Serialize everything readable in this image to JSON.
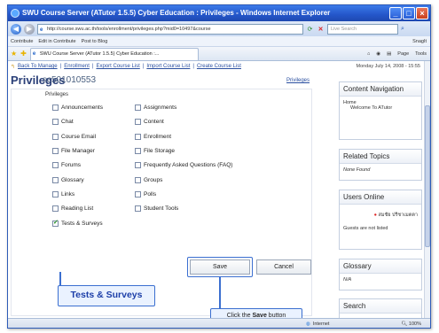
{
  "window": {
    "title": "SWU Course Server (ATutor 1.5.5) Cyber Education : Privileges - Windows Internet Explorer",
    "controls": [
      "_",
      "□",
      "×"
    ]
  },
  "addressbar": {
    "url": "http://course.swu.ac.th/tools/enrollment/privileges.php?mid0=10497&course",
    "search_placeholder": "Live Search"
  },
  "linksbar": {
    "items": [
      "Contribute",
      "Edit in Contribute",
      "Post to Blog"
    ],
    "right_items": [
      "SnagIt"
    ]
  },
  "tabbar": {
    "tab_label": "SWU Course Server (ATutor 1.5.5) Cyber Education :...",
    "commands": [
      "Page",
      "Tools"
    ]
  },
  "page": {
    "breadcrumb": [
      "Back To Manage",
      "Enrollment",
      "Export Course List",
      "Import Course List",
      "Create Course List"
    ],
    "date": "Monday July 14, 2008 - 15:55",
    "title": "Privileges",
    "help_link": "Privileges",
    "username": "sc501010553",
    "privileges_label": "Privileges",
    "privileges": [
      {
        "label": "Announcements",
        "checked": false
      },
      {
        "label": "Assignments",
        "checked": false
      },
      {
        "label": "Chat",
        "checked": false
      },
      {
        "label": "Content",
        "checked": false
      },
      {
        "label": "Course Email",
        "checked": false
      },
      {
        "label": "Enrollment",
        "checked": false
      },
      {
        "label": "File Manager",
        "checked": false
      },
      {
        "label": "File Storage",
        "checked": false
      },
      {
        "label": "Forums",
        "checked": false
      },
      {
        "label": "Frequently Asked Questions (FAQ)",
        "checked": false
      },
      {
        "label": "Glossary",
        "checked": false
      },
      {
        "label": "Groups",
        "checked": false
      },
      {
        "label": "Links",
        "checked": false
      },
      {
        "label": "Polls",
        "checked": false
      },
      {
        "label": "Reading List",
        "checked": false
      },
      {
        "label": "Student Tools",
        "checked": false
      },
      {
        "label": "Tests & Surveys",
        "checked": true
      }
    ],
    "save_label": "Save",
    "cancel_label": "Cancel",
    "callout_label": "Tests & Surveys",
    "tip_prefix": "Click the ",
    "tip_bold": "Save",
    "tip_suffix": " button"
  },
  "sidebar": {
    "panels": [
      {
        "title": "Content Navigation",
        "body_top": "Home",
        "body": "Welcome To ATutor"
      },
      {
        "title": "Related Topics",
        "body": "None Found"
      },
      {
        "title": "Users Online",
        "body_top": "สมชัย ปรีชาเมตตา",
        "body": "Guests are not listed"
      },
      {
        "title": "Glossary",
        "body": "N/A"
      },
      {
        "title": "Search",
        "body": ""
      }
    ]
  },
  "statusbar": {
    "zone": "Internet",
    "zoom": "100%"
  }
}
